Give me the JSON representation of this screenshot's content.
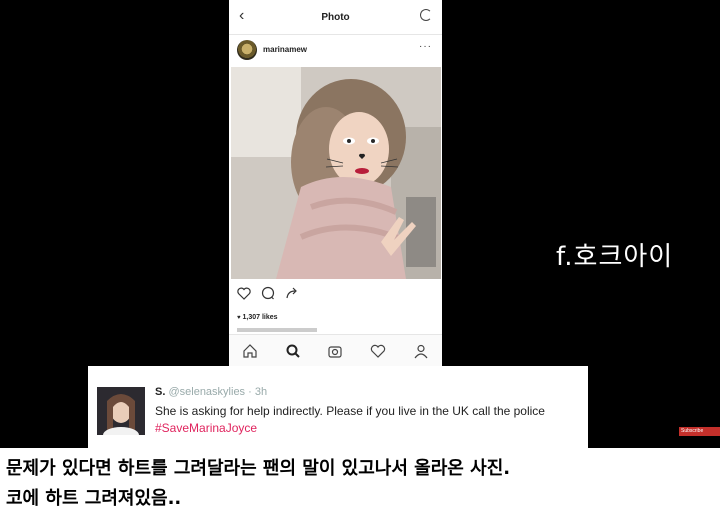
{
  "phone": {
    "nav": {
      "title": "Photo",
      "back_glyph": "‹"
    },
    "post": {
      "username": "marinamew",
      "more_glyph": "···"
    },
    "likes": "1,307 likes",
    "tabs": [
      "home-icon",
      "search-icon",
      "camera-icon",
      "heart-icon",
      "profile-icon"
    ]
  },
  "watermark": "f.호크아이",
  "tweet": {
    "name": "S.",
    "handle": "@selenaskylies · 3h",
    "text": "She is asking for help indirectly. Please if you live in the UK call the police ",
    "hashtag": "#SaveMarinaJoyce"
  },
  "youtube_badge": "Subscribe",
  "caption": {
    "line1": "문제가 있다면 하트를 그려달라는 팬의 말이 있고나서 올라온 사진.",
    "line2": "코에 하트 그려져있음.."
  }
}
